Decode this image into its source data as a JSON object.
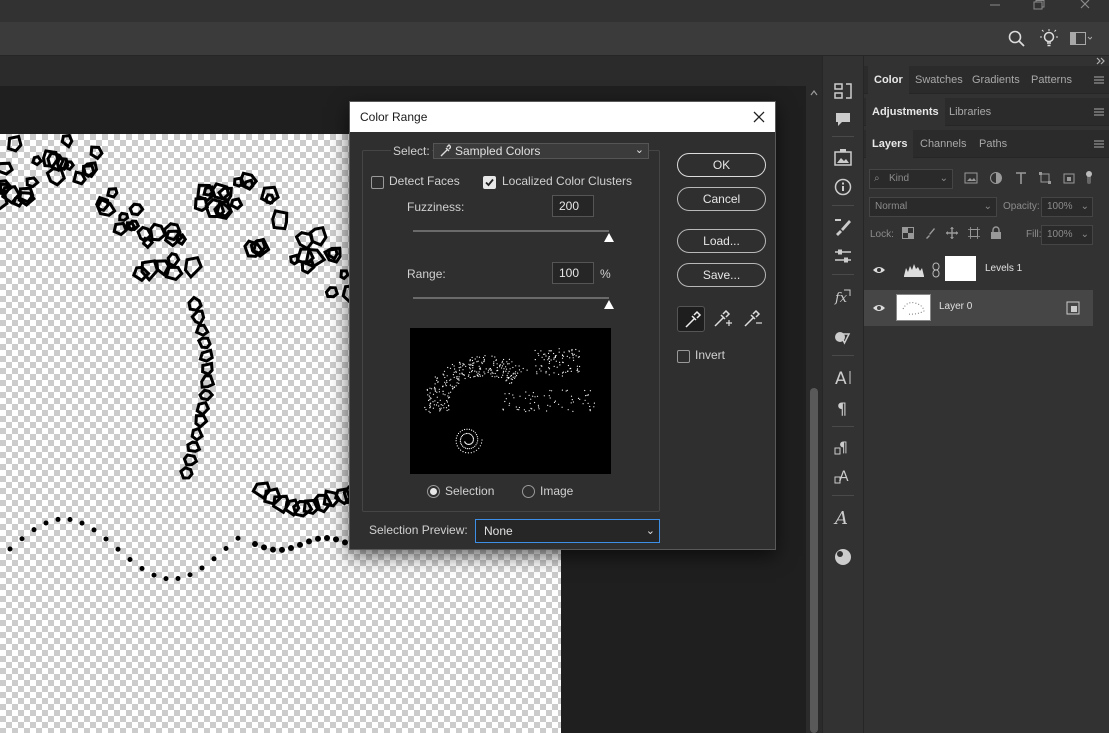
{
  "window": {
    "minimize_icon": "minimize-icon",
    "restore_icon": "restore-icon",
    "close_icon": "close-icon"
  },
  "options_bar": {
    "icons": [
      "search-icon",
      "lightbulb-icon",
      "workspace-icon"
    ]
  },
  "dialog": {
    "title": "Color Range",
    "select_label": "Select:",
    "select_value": "Sampled Colors",
    "detect_faces_label": "Detect Faces",
    "detect_faces_checked": false,
    "localized_label": "Localized Color Clusters",
    "localized_checked": true,
    "fuzziness_label": "Fuzziness:",
    "fuzziness_value": "200",
    "fuzziness_slider_fraction": 1.0,
    "range_label": "Range:",
    "range_value": "100",
    "range_unit": "%",
    "range_slider_fraction": 1.0,
    "radio_selection_label": "Selection",
    "radio_image_label": "Image",
    "radio_selected": "selection",
    "selection_preview_label": "Selection Preview:",
    "selection_preview_value": "None",
    "ok_label": "OK",
    "cancel_label": "Cancel",
    "load_label": "Load...",
    "save_label": "Save...",
    "invert_label": "Invert",
    "invert_checked": false,
    "eyedroppers": [
      "eyedropper-icon",
      "eyedropper-add-icon",
      "eyedropper-subtract-icon"
    ]
  },
  "panels": {
    "top_tabs": [
      "Color",
      "Swatches",
      "Gradients",
      "Patterns"
    ],
    "mid_tabs": [
      "Adjustments",
      "Libraries"
    ],
    "layer_tabs": [
      "Layers",
      "Channels",
      "Paths"
    ],
    "kind_filter": "Kind",
    "blend_mode": "Normal",
    "opacity_label": "Opacity:",
    "opacity_value": "100%",
    "lock_label": "Lock:",
    "fill_label": "Fill:",
    "fill_value": "100%",
    "layers": [
      {
        "name": "Levels 1",
        "type": "adjustment",
        "visible": true,
        "selected": false
      },
      {
        "name": "Layer 0",
        "type": "pixel",
        "visible": true,
        "selected": true
      }
    ]
  },
  "tools": [
    "history-icon",
    "comment-icon",
    "image-icon",
    "info-icon",
    "brush-settings-icon",
    "properties-icon",
    "fx-icon",
    "adjust-icon",
    "character-icon",
    "paragraph-icon",
    "paragraph-styles-icon",
    "character-styles-icon",
    "glyphs-icon",
    "material-icon"
  ],
  "colors": {
    "app_bg": "#1e1e1e",
    "panel_bg": "#323232",
    "dialog_bg": "#2f2f2f",
    "accent_focus": "#3d8ee6"
  }
}
